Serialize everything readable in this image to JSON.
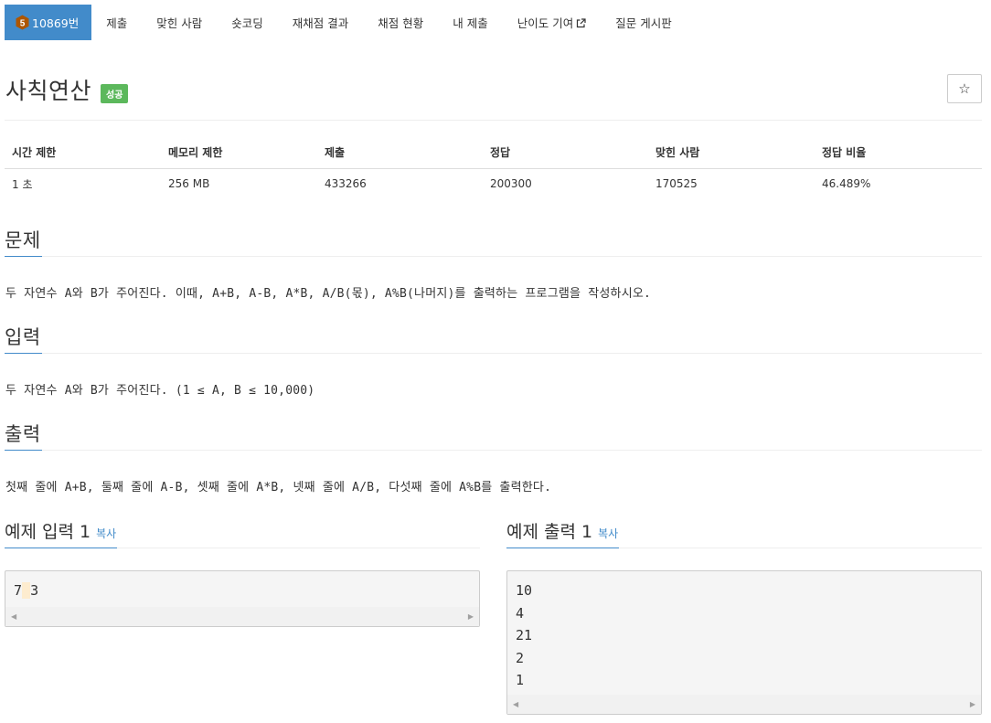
{
  "nav": {
    "problem_number": "10869번",
    "tier_badge_text": "5",
    "tier_color": "#ad5600",
    "items": [
      "제출",
      "맞힌 사람",
      "숏코딩",
      "재채점 결과",
      "채점 현황",
      "내 제출",
      "난이도 기여",
      "질문 게시판"
    ]
  },
  "problem": {
    "title": "사칙연산",
    "status": "성공",
    "star_icon": "☆"
  },
  "info": {
    "headers": [
      "시간 제한",
      "메모리 제한",
      "제출",
      "정답",
      "맞힌 사람",
      "정답 비율"
    ],
    "values": [
      "1 초",
      "256 MB",
      "433266",
      "200300",
      "170525",
      "46.489%"
    ]
  },
  "sections": {
    "description": {
      "heading": "문제",
      "text": "두 자연수 A와 B가 주어진다. 이때, A+B, A-B, A*B, A/B(몫), A%B(나머지)를 출력하는 프로그램을 작성하시오."
    },
    "input": {
      "heading": "입력",
      "text": "두 자연수 A와 B가 주어진다. (1 ≤ A, B ≤ 10,000)"
    },
    "output": {
      "heading": "출력",
      "text": "첫째 줄에 A+B, 둘째 줄에 A-B, 셋째 줄에 A*B, 넷째 줄에 A/B, 다섯째 줄에 A%B를 출력한다."
    }
  },
  "samples": {
    "input_heading": "예제 입력 1",
    "output_heading": "예제 출력 1",
    "copy_label": "복사",
    "input_first": "7",
    "input_space": " ",
    "input_second": "3",
    "output_text": "10\n4\n21\n2\n1"
  },
  "colors": {
    "accent": "#428bca",
    "success": "#5cb85c"
  }
}
